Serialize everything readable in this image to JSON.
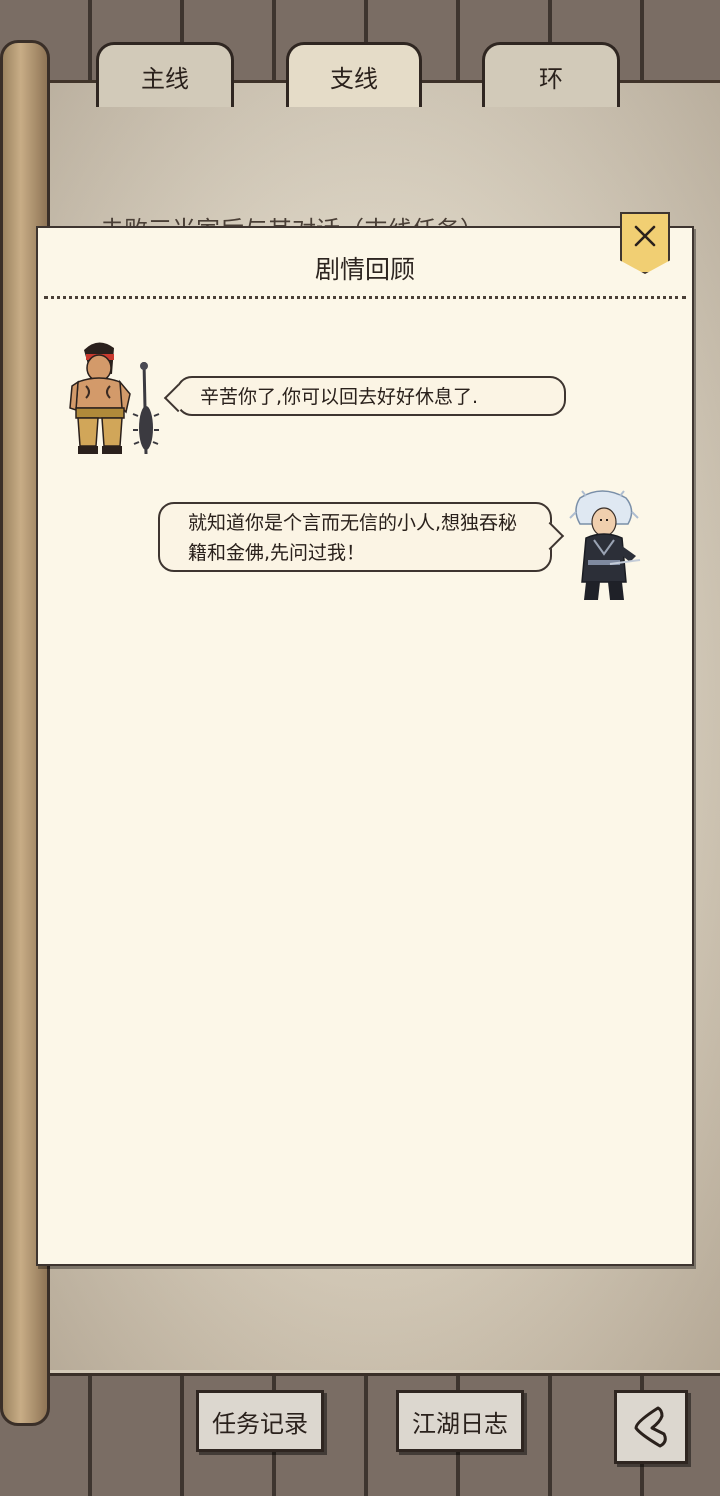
{
  "tabs": [
    {
      "label": "主线",
      "active": false
    },
    {
      "label": "支线",
      "active": true
    },
    {
      "label": "环",
      "active": false
    }
  ],
  "background_task_line": "击败三当家后与其对话（支线任务）",
  "modal": {
    "title": "剧情回顾",
    "close_icon": "close-icon"
  },
  "dialogue": [
    {
      "speaker_side": "left",
      "text": "辛苦你了,你可以回去好好休息了."
    },
    {
      "speaker_side": "right",
      "text": "就知道你是个言而无信的小人,想独吞秘籍和金佛,先问过我！"
    }
  ],
  "bottom": {
    "task_record_label": "任务记录",
    "jianghu_log_label": "江湖日志",
    "back_icon": "back-arrow-icon"
  },
  "colors": {
    "parchment": "#fcf7e8",
    "close_button": "#f1cf73",
    "wood": "#7a6d64"
  }
}
